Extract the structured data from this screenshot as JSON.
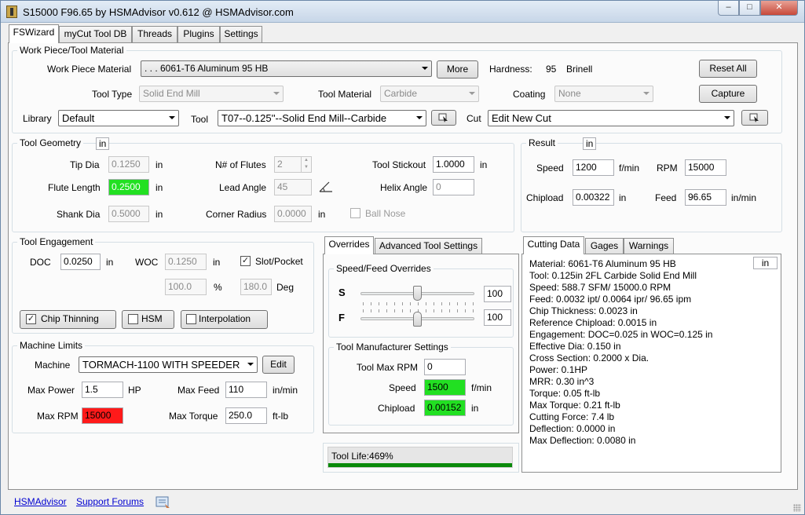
{
  "window": {
    "title": "S15000 F96.65 by HSMAdvisor v0.612 @ HSMAdvisor.com",
    "minimize": "–",
    "maximize": "□",
    "close": "✕"
  },
  "main_tabs": [
    "FSWizard",
    "myCut Tool DB",
    "Threads",
    "Plugins",
    "Settings"
  ],
  "workpiece": {
    "group_title": "Work Piece/Tool Material",
    "material_label": "Work Piece Material",
    "material_value": ". . . 6061-T6 Aluminum 95 HB",
    "more_button": "More",
    "hardness_label": "Hardness:",
    "hardness_value": "95",
    "hardness_unit": "Brinell",
    "reset_all_button": "Reset All",
    "capture_button": "Capture",
    "tool_type_label": "Tool Type",
    "tool_type_value": "Solid End Mill",
    "tool_material_label": "Tool Material",
    "tool_material_value": "Carbide",
    "coating_label": "Coating",
    "coating_value": "None",
    "library_label": "Library",
    "library_value": "Default",
    "tool_label": "Tool",
    "tool_value": "T07--0.125''--Solid End Mill--Carbide",
    "cut_label": "Cut",
    "cut_value": "Edit New Cut"
  },
  "geometry": {
    "group_title": "Tool Geometry",
    "unit": "in",
    "tip_dia_label": "Tip Dia",
    "tip_dia_value": "0.1250",
    "flute_length_label": "Flute Length",
    "flute_length_value": "0.2500",
    "shank_dia_label": "Shank Dia",
    "shank_dia_value": "0.5000",
    "flutes_label": "N# of Flutes",
    "flutes_value": "2",
    "lead_angle_label": "Lead Angle",
    "lead_angle_value": "45",
    "corner_radius_label": "Corner Radius",
    "corner_radius_value": "0.0000",
    "stickout_label": "Tool Stickout",
    "stickout_value": "1.0000",
    "helix_label": "Helix Angle",
    "helix_value": "0",
    "ball_nose_label": "Ball Nose",
    "in_unit": "in"
  },
  "result": {
    "group_title": "Result",
    "unit": "in",
    "speed_label": "Speed",
    "speed_value": "1200",
    "speed_unit": "f/min",
    "rpm_label": "RPM",
    "rpm_value": "15000",
    "chipload_label": "Chipload",
    "chipload_value": "0.00322",
    "chipload_unit": "in",
    "feed_label": "Feed",
    "feed_value": "96.65",
    "feed_unit": "in/min"
  },
  "engagement": {
    "group_title": "Tool Engagement",
    "doc_label": "DOC",
    "doc_value": "0.0250",
    "doc_unit": "in",
    "woc_label": "WOC",
    "woc_value": "0.1250",
    "woc_unit": "in",
    "slot_label": "Slot/Pocket",
    "woc_pct_value": "100.0",
    "pct_unit": "%",
    "deg_value": "180.0",
    "deg_unit": "Deg",
    "chip_thinning_label": "Chip Thinning",
    "hsm_label": "HSM",
    "interpolation_label": "Interpolation"
  },
  "machine": {
    "group_title": "Machine Limits",
    "machine_label": "Machine",
    "machine_value": "TORMACH-1100 WITH SPEEDER",
    "edit_button": "Edit",
    "max_power_label": "Max Power",
    "max_power_value": "1.5",
    "max_power_unit": "HP",
    "max_feed_label": "Max Feed",
    "max_feed_value": "110",
    "max_feed_unit": "in/min",
    "max_rpm_label": "Max RPM",
    "max_rpm_value": "15000",
    "max_torque_label": "Max Torque",
    "max_torque_value": "250.0",
    "max_torque_unit": "ft-lb"
  },
  "overrides": {
    "tabs": [
      "Overrides",
      "Advanced Tool Settings"
    ],
    "speed_feed_title": "Speed/Feed Overrides",
    "s_label": "S",
    "s_value": "100",
    "s_fraction": 0.5,
    "f_label": "F",
    "f_value": "100",
    "f_fraction": 0.5,
    "manufacturer_title": "Tool Manufacturer Settings",
    "max_rpm_label": "Tool Max RPM",
    "max_rpm_value": "0",
    "speed_label": "Speed",
    "speed_value": "1500",
    "speed_unit": "f/min",
    "chipload_label": "Chipload",
    "chipload_value": "0.00152",
    "chipload_unit": "in"
  },
  "tool_life": {
    "label": "Tool Life:469%",
    "fraction": 1.0,
    "color": "#0a8a0a"
  },
  "cutting_data": {
    "tabs": [
      "Cutting Data",
      "Gages",
      "Warnings"
    ],
    "unit": "in",
    "lines": [
      "Material: 6061-T6 Aluminum 95 HB",
      "Tool: 0.125in 2FL Carbide  Solid End Mill",
      "Speed: 588.7 SFM/ 15000.0 RPM",
      "Feed: 0.0032 ipt/ 0.0064 ipr/ 96.65 ipm",
      "Chip Thickness: 0.0023 in",
      "Reference Chipload: 0.0015 in",
      "Engagement:  DOC=0.025 in   WOC=0.125 in",
      "Effective Dia: 0.150 in",
      "Cross Section: 0.2000 x Dia.",
      "Power: 0.1HP",
      "MRR: 0.30 in^3",
      "Torque: 0.05 ft-lb",
      "Max Torque: 0.21 ft-lb",
      "Cutting Force: 7.4 lb",
      "Deflection: 0.0000 in",
      "Max Deflection: 0.0080 in"
    ]
  },
  "footer": {
    "link1": "HSMAdvisor",
    "link2": "Support Forums"
  },
  "icons": {
    "pick_tool": "picker-icon",
    "pick_cut": "picker-icon",
    "lead_angle": "angle-icon",
    "footer": "form-icon"
  }
}
